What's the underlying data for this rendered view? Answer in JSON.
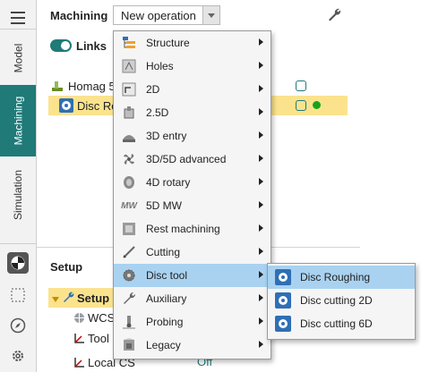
{
  "left_tabs": [
    {
      "label": "Model"
    },
    {
      "label": "Machining"
    },
    {
      "label": "Simulation"
    }
  ],
  "header": {
    "title": "Machining",
    "operation_select": "New operation"
  },
  "links": {
    "label": "Links",
    "enabled": true
  },
  "tree": {
    "machine": "Homag 5",
    "part": "Disc Ro"
  },
  "setup": {
    "title": "Setup",
    "rows": [
      {
        "label": "Setup"
      },
      {
        "label": "WCS"
      },
      {
        "label": "Tool"
      },
      {
        "label": "Local CS"
      }
    ],
    "local_cs_value": "Off"
  },
  "menu": {
    "items": [
      {
        "label": "Structure",
        "icon": "structure-icon"
      },
      {
        "label": "Holes",
        "icon": "holes-icon"
      },
      {
        "label": "2D",
        "icon": "2d-icon"
      },
      {
        "label": "2.5D",
        "icon": "2-5d-icon"
      },
      {
        "label": "3D entry",
        "icon": "3d-entry-icon"
      },
      {
        "label": "3D/5D advanced",
        "icon": "fan-icon"
      },
      {
        "label": "4D rotary",
        "icon": "rotary-icon"
      },
      {
        "label": "5D MW",
        "icon": "mw-icon"
      },
      {
        "label": "Rest machining",
        "icon": "rest-icon"
      },
      {
        "label": "Cutting",
        "icon": "cutting-icon"
      },
      {
        "label": "Disc tool",
        "icon": "disc-tool-icon"
      },
      {
        "label": "Auxiliary",
        "icon": "wrench-icon"
      },
      {
        "label": "Probing",
        "icon": "probing-icon"
      },
      {
        "label": "Legacy",
        "icon": "legacy-icon"
      }
    ],
    "mw_text": "MW"
  },
  "submenu": {
    "items": [
      {
        "label": "Disc Roughing"
      },
      {
        "label": "Disc cutting 2D"
      },
      {
        "label": "Disc cutting 6D"
      }
    ]
  },
  "colors": {
    "accent": "#1f7a78",
    "highlight_row": "#fbe38e",
    "menu_highlight": "#a9d2f0",
    "status_green": "#1aa31a"
  }
}
